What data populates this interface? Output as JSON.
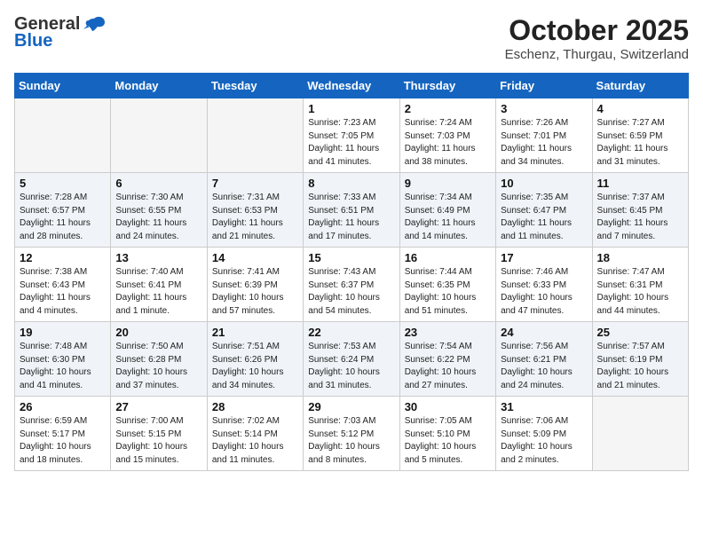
{
  "header": {
    "logo_general": "General",
    "logo_blue": "Blue",
    "month_title": "October 2025",
    "location": "Eschenz, Thurgau, Switzerland"
  },
  "days_of_week": [
    "Sunday",
    "Monday",
    "Tuesday",
    "Wednesday",
    "Thursday",
    "Friday",
    "Saturday"
  ],
  "weeks": [
    [
      {
        "day": "",
        "info": ""
      },
      {
        "day": "",
        "info": ""
      },
      {
        "day": "",
        "info": ""
      },
      {
        "day": "1",
        "info": "Sunrise: 7:23 AM\nSunset: 7:05 PM\nDaylight: 11 hours\nand 41 minutes."
      },
      {
        "day": "2",
        "info": "Sunrise: 7:24 AM\nSunset: 7:03 PM\nDaylight: 11 hours\nand 38 minutes."
      },
      {
        "day": "3",
        "info": "Sunrise: 7:26 AM\nSunset: 7:01 PM\nDaylight: 11 hours\nand 34 minutes."
      },
      {
        "day": "4",
        "info": "Sunrise: 7:27 AM\nSunset: 6:59 PM\nDaylight: 11 hours\nand 31 minutes."
      }
    ],
    [
      {
        "day": "5",
        "info": "Sunrise: 7:28 AM\nSunset: 6:57 PM\nDaylight: 11 hours\nand 28 minutes."
      },
      {
        "day": "6",
        "info": "Sunrise: 7:30 AM\nSunset: 6:55 PM\nDaylight: 11 hours\nand 24 minutes."
      },
      {
        "day": "7",
        "info": "Sunrise: 7:31 AM\nSunset: 6:53 PM\nDaylight: 11 hours\nand 21 minutes."
      },
      {
        "day": "8",
        "info": "Sunrise: 7:33 AM\nSunset: 6:51 PM\nDaylight: 11 hours\nand 17 minutes."
      },
      {
        "day": "9",
        "info": "Sunrise: 7:34 AM\nSunset: 6:49 PM\nDaylight: 11 hours\nand 14 minutes."
      },
      {
        "day": "10",
        "info": "Sunrise: 7:35 AM\nSunset: 6:47 PM\nDaylight: 11 hours\nand 11 minutes."
      },
      {
        "day": "11",
        "info": "Sunrise: 7:37 AM\nSunset: 6:45 PM\nDaylight: 11 hours\nand 7 minutes."
      }
    ],
    [
      {
        "day": "12",
        "info": "Sunrise: 7:38 AM\nSunset: 6:43 PM\nDaylight: 11 hours\nand 4 minutes."
      },
      {
        "day": "13",
        "info": "Sunrise: 7:40 AM\nSunset: 6:41 PM\nDaylight: 11 hours\nand 1 minute."
      },
      {
        "day": "14",
        "info": "Sunrise: 7:41 AM\nSunset: 6:39 PM\nDaylight: 10 hours\nand 57 minutes."
      },
      {
        "day": "15",
        "info": "Sunrise: 7:43 AM\nSunset: 6:37 PM\nDaylight: 10 hours\nand 54 minutes."
      },
      {
        "day": "16",
        "info": "Sunrise: 7:44 AM\nSunset: 6:35 PM\nDaylight: 10 hours\nand 51 minutes."
      },
      {
        "day": "17",
        "info": "Sunrise: 7:46 AM\nSunset: 6:33 PM\nDaylight: 10 hours\nand 47 minutes."
      },
      {
        "day": "18",
        "info": "Sunrise: 7:47 AM\nSunset: 6:31 PM\nDaylight: 10 hours\nand 44 minutes."
      }
    ],
    [
      {
        "day": "19",
        "info": "Sunrise: 7:48 AM\nSunset: 6:30 PM\nDaylight: 10 hours\nand 41 minutes."
      },
      {
        "day": "20",
        "info": "Sunrise: 7:50 AM\nSunset: 6:28 PM\nDaylight: 10 hours\nand 37 minutes."
      },
      {
        "day": "21",
        "info": "Sunrise: 7:51 AM\nSunset: 6:26 PM\nDaylight: 10 hours\nand 34 minutes."
      },
      {
        "day": "22",
        "info": "Sunrise: 7:53 AM\nSunset: 6:24 PM\nDaylight: 10 hours\nand 31 minutes."
      },
      {
        "day": "23",
        "info": "Sunrise: 7:54 AM\nSunset: 6:22 PM\nDaylight: 10 hours\nand 27 minutes."
      },
      {
        "day": "24",
        "info": "Sunrise: 7:56 AM\nSunset: 6:21 PM\nDaylight: 10 hours\nand 24 minutes."
      },
      {
        "day": "25",
        "info": "Sunrise: 7:57 AM\nSunset: 6:19 PM\nDaylight: 10 hours\nand 21 minutes."
      }
    ],
    [
      {
        "day": "26",
        "info": "Sunrise: 6:59 AM\nSunset: 5:17 PM\nDaylight: 10 hours\nand 18 minutes."
      },
      {
        "day": "27",
        "info": "Sunrise: 7:00 AM\nSunset: 5:15 PM\nDaylight: 10 hours\nand 15 minutes."
      },
      {
        "day": "28",
        "info": "Sunrise: 7:02 AM\nSunset: 5:14 PM\nDaylight: 10 hours\nand 11 minutes."
      },
      {
        "day": "29",
        "info": "Sunrise: 7:03 AM\nSunset: 5:12 PM\nDaylight: 10 hours\nand 8 minutes."
      },
      {
        "day": "30",
        "info": "Sunrise: 7:05 AM\nSunset: 5:10 PM\nDaylight: 10 hours\nand 5 minutes."
      },
      {
        "day": "31",
        "info": "Sunrise: 7:06 AM\nSunset: 5:09 PM\nDaylight: 10 hours\nand 2 minutes."
      },
      {
        "day": "",
        "info": ""
      }
    ]
  ]
}
